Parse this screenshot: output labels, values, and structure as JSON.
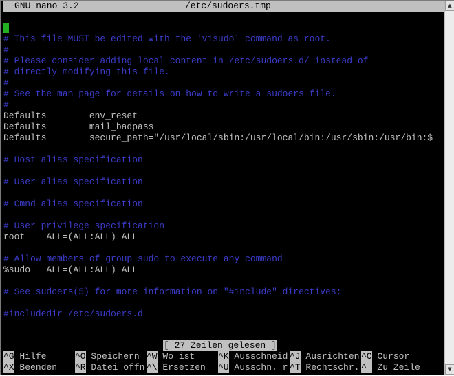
{
  "titlebar": {
    "app": "GNU nano 3.2",
    "file": "/etc/sudoers.tmp"
  },
  "editor": {
    "cursor_char": "#",
    "lines": [
      {
        "text": "",
        "type": "cursor"
      },
      {
        "text": "# This file MUST be edited with the 'visudo' command as root.",
        "type": "comment"
      },
      {
        "text": "#",
        "type": "comment"
      },
      {
        "text": "# Please consider adding local content in /etc/sudoers.d/ instead of",
        "type": "comment"
      },
      {
        "text": "# directly modifying this file.",
        "type": "comment"
      },
      {
        "text": "#",
        "type": "comment"
      },
      {
        "text": "# See the man page for details on how to write a sudoers file.",
        "type": "comment"
      },
      {
        "text": "#",
        "type": "comment"
      },
      {
        "text": "Defaults        env_reset",
        "type": "plain"
      },
      {
        "text": "Defaults        mail_badpass",
        "type": "plain"
      },
      {
        "text": "Defaults        secure_path=\"/usr/local/sbin:/usr/local/bin:/usr/sbin:/usr/bin:$",
        "type": "plain"
      },
      {
        "text": "",
        "type": "plain"
      },
      {
        "text": "# Host alias specification",
        "type": "comment"
      },
      {
        "text": "",
        "type": "plain"
      },
      {
        "text": "# User alias specification",
        "type": "comment"
      },
      {
        "text": "",
        "type": "plain"
      },
      {
        "text": "# Cmnd alias specification",
        "type": "comment"
      },
      {
        "text": "",
        "type": "plain"
      },
      {
        "text": "# User privilege specification",
        "type": "comment"
      },
      {
        "text": "root    ALL=(ALL:ALL) ALL",
        "type": "plain"
      },
      {
        "text": "",
        "type": "plain"
      },
      {
        "text": "# Allow members of group sudo to execute any command",
        "type": "comment"
      },
      {
        "text": "%sudo   ALL=(ALL:ALL) ALL",
        "type": "plain"
      },
      {
        "text": "",
        "type": "plain"
      },
      {
        "text": "# See sudoers(5) for more information on \"#include\" directives:",
        "type": "comment"
      },
      {
        "text": "",
        "type": "plain"
      },
      {
        "text": "#includedir /etc/sudoers.d",
        "type": "comment"
      }
    ]
  },
  "status": {
    "message": "[ 27 Zeilen gelesen ]"
  },
  "shortcuts": {
    "row1": [
      {
        "key": "^G",
        "label": " Hilfe"
      },
      {
        "key": "^O",
        "label": " Speichern"
      },
      {
        "key": "^W",
        "label": " Wo ist"
      },
      {
        "key": "^K",
        "label": " Ausschneid"
      },
      {
        "key": "^J",
        "label": " Ausrichten"
      },
      {
        "key": "^C",
        "label": " Cursor"
      }
    ],
    "row2": [
      {
        "key": "^X",
        "label": " Beenden"
      },
      {
        "key": "^R",
        "label": " Datei öffn"
      },
      {
        "key": "^\\",
        "label": " Ersetzen"
      },
      {
        "key": "^U",
        "label": " Ausschn. r"
      },
      {
        "key": "^T",
        "label": " Rechtschr."
      },
      {
        "key": "^_",
        "label": " Zu Zeile"
      }
    ]
  },
  "colors": {
    "background": "#000000",
    "text": "#c0c0c0",
    "comment": "#3b3bc8",
    "cursor": "#23b023",
    "bar": "#c0c0c0"
  }
}
